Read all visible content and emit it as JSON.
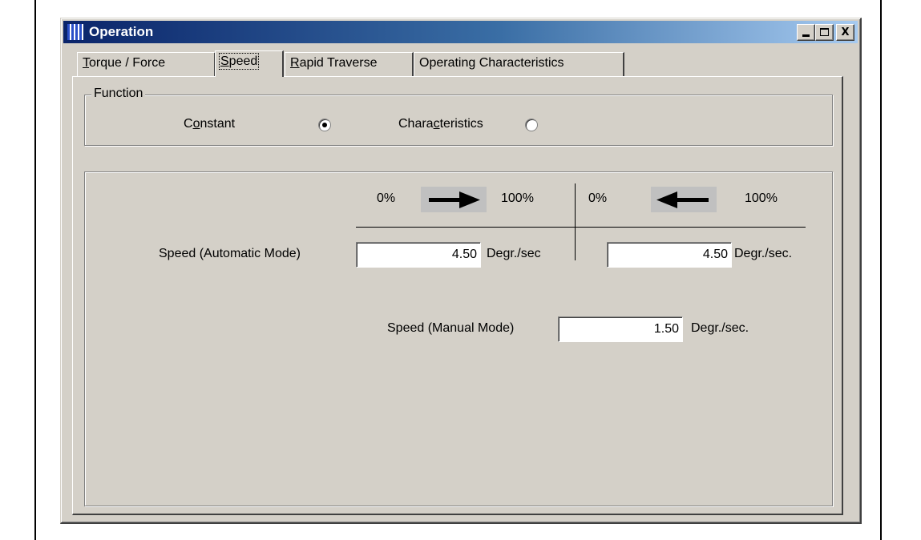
{
  "window": {
    "title": "Operation",
    "buttons": {
      "minimize": "_",
      "maximize": "□",
      "close": "X"
    }
  },
  "tabs": [
    {
      "label_u": "T",
      "label_rest": "orque / Force",
      "active": false
    },
    {
      "label_u": "S",
      "label_rest": "peed",
      "active": true
    },
    {
      "label_u": "R",
      "label_rest": "apid Traverse",
      "active": false
    },
    {
      "label_u": "",
      "label_rest": "Operating Characteristics",
      "active": false
    }
  ],
  "function_group": {
    "legend": "Function",
    "constant": {
      "pre": "C",
      "u": "o",
      "post": "nstant",
      "checked": true
    },
    "characteristics": {
      "pre": "Chara",
      "u": "c",
      "post": "teristics",
      "checked": false
    }
  },
  "speed": {
    "forward": {
      "start_label": "0%",
      "end_label": "100%",
      "direction": "right-arrow"
    },
    "reverse": {
      "start_label": "0%",
      "end_label": "100%",
      "direction": "left-arrow"
    },
    "automatic": {
      "label": "Speed (Automatic Mode)",
      "forward_value": "4.50",
      "forward_unit": "Degr./sec",
      "reverse_value": "4.50",
      "reverse_unit": "Degr./sec."
    },
    "manual": {
      "label": "Speed (Manual Mode)",
      "value": "1.50",
      "unit": "Degr./sec."
    }
  }
}
